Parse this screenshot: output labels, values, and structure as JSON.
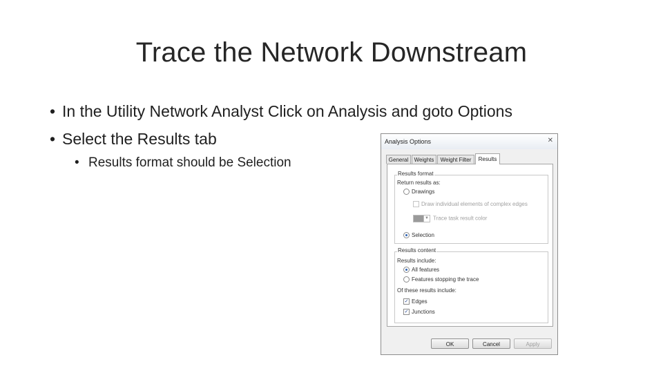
{
  "slide": {
    "title": "Trace the Network Downstream",
    "bullets": [
      "In the Utility Network Analyst Click on Analysis and goto Options",
      "Select the Results tab"
    ],
    "sub_bullets": [
      "Results format should be Selection"
    ]
  },
  "dialog": {
    "title": "Analysis Options",
    "close_glyph": "✕",
    "tabs": [
      "General",
      "Weights",
      "Weight Filter",
      "Results"
    ],
    "active_tab": "Results",
    "results_format": {
      "group_label": "Results format",
      "return_label": "Return results as:",
      "drawings_label": "Drawings",
      "draw_individual_label": "Draw individual elements of complex edges",
      "trace_color_label": "Trace task result color",
      "selection_label": "Selection",
      "selected": "Selection"
    },
    "results_content": {
      "group_label": "Results content",
      "include_label": "Results include:",
      "all_features_label": "All features",
      "stopping_label": "Features stopping the trace",
      "selected": "All features",
      "of_these_label": "Of these results include:",
      "edges_label": "Edges",
      "junctions_label": "Junctions",
      "edges_checked": true,
      "junctions_checked": true
    },
    "buttons": {
      "ok": "OK",
      "cancel": "Cancel",
      "apply": "Apply"
    }
  },
  "colors": {
    "accent": "#2a5fb0",
    "dialog_bg": "#f0f0f0",
    "disabled_text": "#a0a0a0"
  },
  "icons": {
    "close": "close-icon",
    "dropdown": "chevron-down-icon",
    "check": "checkmark-icon"
  }
}
